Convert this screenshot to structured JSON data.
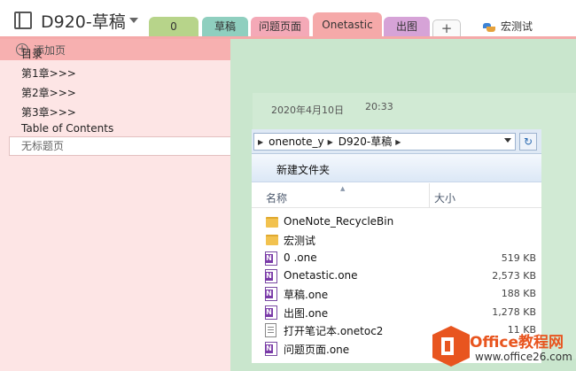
{
  "notebook": {
    "title": "D920-草稿",
    "icon": "notebook-icon"
  },
  "sections": [
    {
      "label": "0",
      "color": "#b7d48a"
    },
    {
      "label": "草稿",
      "color": "#8fcfbf"
    },
    {
      "label": "问题页面",
      "color": "#f4a9b7"
    },
    {
      "label": "Onetastic",
      "color": "#f5a9a9",
      "active": true
    },
    {
      "label": "出图",
      "color": "#d6a3d7"
    }
  ],
  "add_section_label": "+",
  "macro": {
    "label": "宏测试",
    "icon": "macro-icon"
  },
  "page_panel": {
    "add_page_label": "添加页",
    "pages": [
      "目录",
      "第1章>>>",
      "第2章>>>",
      "第3章>>>",
      "Table of Contents"
    ],
    "selected_page": "无标题页"
  },
  "page": {
    "date": "2020年4月10日",
    "time": "20:33"
  },
  "explorer": {
    "breadcrumb": [
      "onenote_y",
      "D920-草稿"
    ],
    "new_folder_label": "新建文件夹",
    "columns": {
      "name": "名称",
      "size": "大小"
    },
    "files": [
      {
        "name": "OneNote_RecycleBin",
        "size": "",
        "type": "folder"
      },
      {
        "name": "宏测试",
        "size": "",
        "type": "folder"
      },
      {
        "name": "0 .one",
        "size": "519 KB",
        "type": "one"
      },
      {
        "name": "Onetastic.one",
        "size": "2,573 KB",
        "type": "one"
      },
      {
        "name": "草稿.one",
        "size": "188 KB",
        "type": "one"
      },
      {
        "name": "出图.one",
        "size": "1,278 KB",
        "type": "one"
      },
      {
        "name": "打开笔记本.onetoc2",
        "size": "11 KB",
        "type": "toc"
      },
      {
        "name": "问题页面.one",
        "size": "",
        "type": "one"
      }
    ]
  },
  "watermark": {
    "line1": "Office教程网",
    "line2": "www.office26.com"
  },
  "colors": {
    "accent": "#f5a9a9",
    "page_bg": "#c9e6cd",
    "panel_bg": "#fde5e5",
    "watermark_orange": "#e8551f"
  }
}
